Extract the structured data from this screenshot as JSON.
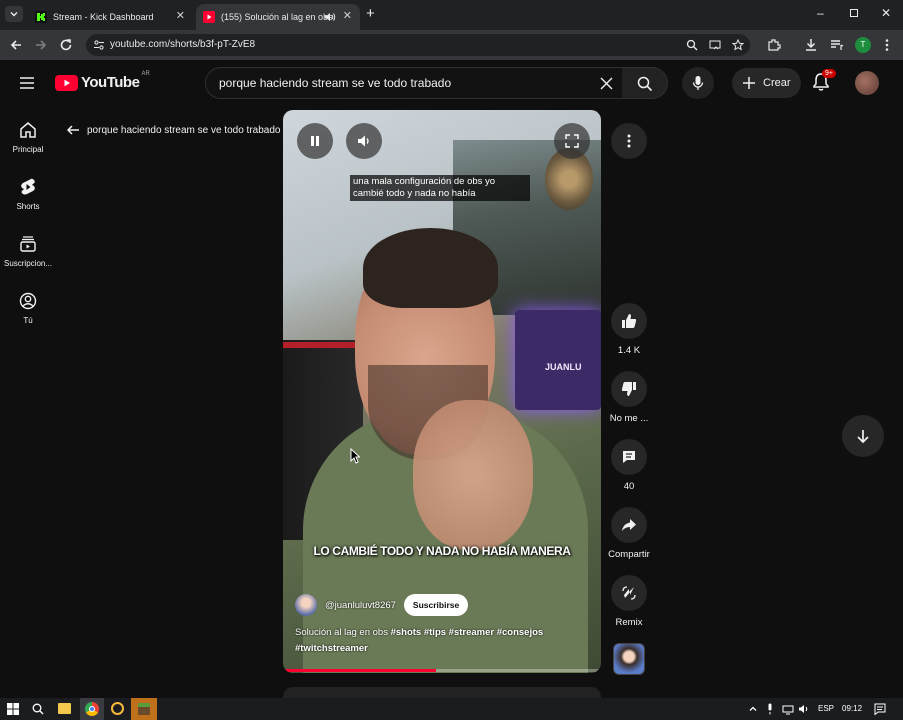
{
  "browser": {
    "tabs": [
      {
        "label": "Stream - Kick Dashboard",
        "favicon_color": "#53fc18"
      },
      {
        "label": "(155) Solución al lag en obs",
        "favicon_color": "#ff0033"
      }
    ],
    "url": "youtube.com/shorts/b3f-pT-ZvE8",
    "profile_initial": "T"
  },
  "youtube": {
    "logo_text": "YouTube",
    "country_code": "AR",
    "search_value": "porque haciendo stream se ve todo trabado",
    "create_label": "Crear",
    "notification_badge": "9+"
  },
  "sidebar": {
    "items": [
      {
        "label": "Principal",
        "icon": "home-icon"
      },
      {
        "label": "Shorts",
        "icon": "shorts-icon"
      },
      {
        "label": "Suscripcion...",
        "icon": "subscriptions-icon"
      },
      {
        "label": "Tú",
        "icon": "you-icon"
      }
    ]
  },
  "shorts": {
    "back_title": "porque haciendo stream se ve todo trabado",
    "caption_top": "una mala configuración de obs yo cambié todo y nada no había",
    "caption_bottom": "LO CAMBIÉ TODO Y NADA NO HABÍA MANERA",
    "channel_handle": "@juanluluvt8267",
    "subscribe_label": "Suscribirse",
    "description_line1_text": "Solución al lag en obs ",
    "hashtags_line1": "#shots #tips #streamer #consejos",
    "hashtags_line2": "#twitchstreamer",
    "neon_sign_text": "JUANLU",
    "actions": {
      "likes": "1.4 K",
      "dislike_label": "No me ...",
      "comments": "40",
      "share_label": "Compartir",
      "remix_label": "Remix"
    }
  },
  "taskbar": {
    "language": "ESP",
    "time": "09:12"
  },
  "colors": {
    "youtube_red": "#ff0033",
    "background": "#0f0f0f",
    "progress": "#ff0033",
    "neon_purple": "#8b5cf6"
  }
}
